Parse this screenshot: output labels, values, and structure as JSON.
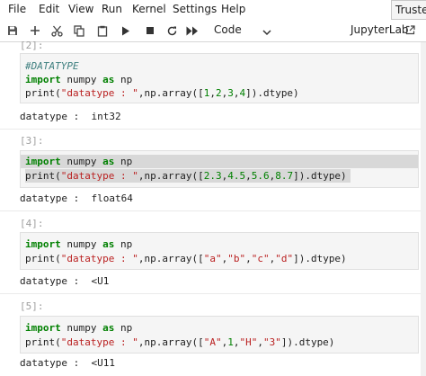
{
  "menubar": {
    "items": [
      "File",
      "Edit",
      "View",
      "Run",
      "Kernel",
      "Settings",
      "Help"
    ],
    "trusted_label": "Trusted"
  },
  "toolbar": {
    "cell_type": "Code",
    "jupyterlab_label": "JupyterLab",
    "icons": [
      "save-icon",
      "add-icon",
      "cut-icon",
      "copy-icon",
      "paste-icon",
      "run-icon",
      "stop-icon",
      "restart-icon",
      "fast-forward-icon"
    ]
  },
  "cells": [
    {
      "prompt": "[2]:",
      "lines": [
        [
          {
            "t": "#DATATYPE",
            "c": "cm"
          }
        ],
        [
          {
            "t": "import",
            "c": "kw"
          },
          {
            "t": " numpy ",
            "c": ""
          },
          {
            "t": "as",
            "c": "kw"
          },
          {
            "t": " np",
            "c": ""
          }
        ],
        [
          {
            "t": "print(",
            "c": ""
          },
          {
            "t": "\"datatype : \"",
            "c": "st"
          },
          {
            "t": ",np.array([",
            "c": ""
          },
          {
            "t": "1",
            "c": "nu"
          },
          {
            "t": ",",
            "c": ""
          },
          {
            "t": "2",
            "c": "nu"
          },
          {
            "t": ",",
            "c": ""
          },
          {
            "t": "3",
            "c": "nu"
          },
          {
            "t": ",",
            "c": ""
          },
          {
            "t": "4",
            "c": "nu"
          },
          {
            "t": "]).dtype)",
            "c": ""
          }
        ]
      ],
      "output": "datatype :  int32"
    },
    {
      "prompt": "[3]:",
      "lines": [
        [
          {
            "t": "import",
            "c": "kw"
          },
          {
            "t": " numpy ",
            "c": ""
          },
          {
            "t": "as",
            "c": "kw"
          },
          {
            "t": " np",
            "c": ""
          }
        ],
        [
          {
            "t": "print(",
            "c": ""
          },
          {
            "t": "\"datatype : \"",
            "c": "st"
          },
          {
            "t": ",np.array([",
            "c": ""
          },
          {
            "t": "2.3",
            "c": "nu"
          },
          {
            "t": ",",
            "c": ""
          },
          {
            "t": "4.5",
            "c": "nu"
          },
          {
            "t": ",",
            "c": ""
          },
          {
            "t": "5.6",
            "c": "nu"
          },
          {
            "t": ",",
            "c": ""
          },
          {
            "t": "8.7",
            "c": "nu"
          },
          {
            "t": "]).dtype)",
            "c": ""
          }
        ]
      ],
      "output": "datatype :  float64"
    },
    {
      "prompt": "[4]:",
      "lines": [
        [
          {
            "t": "import",
            "c": "kw"
          },
          {
            "t": " numpy ",
            "c": ""
          },
          {
            "t": "as",
            "c": "kw"
          },
          {
            "t": " np",
            "c": ""
          }
        ],
        [
          {
            "t": "print(",
            "c": ""
          },
          {
            "t": "\"datatype : \"",
            "c": "st"
          },
          {
            "t": ",np.array([",
            "c": ""
          },
          {
            "t": "\"a\"",
            "c": "st"
          },
          {
            "t": ",",
            "c": ""
          },
          {
            "t": "\"b\"",
            "c": "st"
          },
          {
            "t": ",",
            "c": ""
          },
          {
            "t": "\"c\"",
            "c": "st"
          },
          {
            "t": ",",
            "c": ""
          },
          {
            "t": "\"d\"",
            "c": "st"
          },
          {
            "t": "]).dtype)",
            "c": ""
          }
        ]
      ],
      "output": "datatype :  <U1"
    },
    {
      "prompt": "[5]:",
      "lines": [
        [
          {
            "t": "import",
            "c": "kw"
          },
          {
            "t": " numpy ",
            "c": ""
          },
          {
            "t": "as",
            "c": "kw"
          },
          {
            "t": " np",
            "c": ""
          }
        ],
        [
          {
            "t": "print(",
            "c": ""
          },
          {
            "t": "\"datatype : \"",
            "c": "st"
          },
          {
            "t": ",np.array([",
            "c": ""
          },
          {
            "t": "\"A\"",
            "c": "st"
          },
          {
            "t": ",",
            "c": ""
          },
          {
            "t": "1",
            "c": "nu"
          },
          {
            "t": ",",
            "c": ""
          },
          {
            "t": "\"H\"",
            "c": "st"
          },
          {
            "t": ",",
            "c": ""
          },
          {
            "t": "\"3\"",
            "c": "st"
          },
          {
            "t": "]).dtype)",
            "c": ""
          }
        ]
      ],
      "output": "datatype :  <U11"
    }
  ]
}
